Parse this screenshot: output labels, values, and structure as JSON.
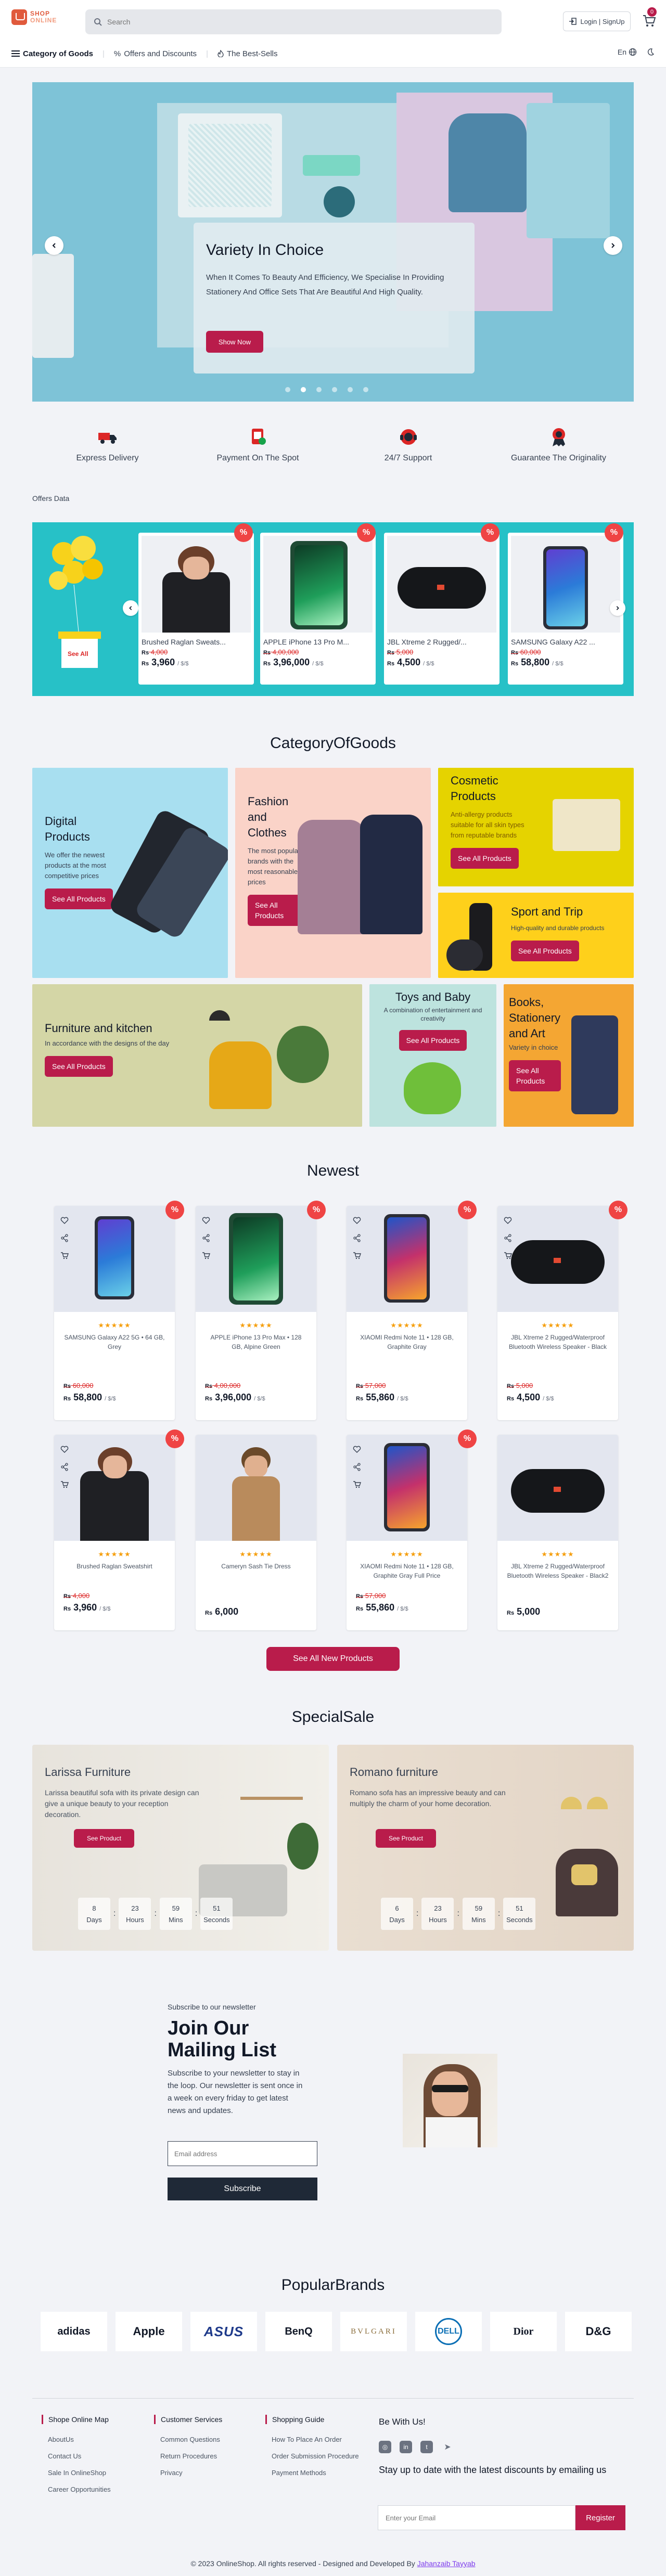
{
  "header": {
    "logo_line1": "SHOP",
    "logo_line2": "ONLINE",
    "search_placeholder": "Search",
    "login_label": "Login | SignUp",
    "cart_count": "0"
  },
  "nav": {
    "category": "Category of Goods",
    "offers": "Offers and Discounts",
    "best": "The Best-Sells",
    "lang": "En"
  },
  "hero": {
    "title": "Variety In Choice",
    "description": "When It Comes To Beauty And Efficiency, We Specialise In Providing Stationery And Office Sets That Are Beautiful And High Quality.",
    "button": "Show Now",
    "slide_count": 6,
    "active_slide": 2
  },
  "features": [
    {
      "label": "Express Delivery",
      "icon": "delivery-truck-icon"
    },
    {
      "label": "Payment On The Spot",
      "icon": "payment-icon"
    },
    {
      "label": "24/7 Support",
      "icon": "support-icon"
    },
    {
      "label": "Guarantee The Originality",
      "icon": "badge-icon"
    }
  ],
  "offers": {
    "section_label": "Offers Data",
    "gift_label": "See All",
    "items": [
      {
        "name": "Brushed Raglan Sweats...",
        "old": "4,000",
        "price": "3,960",
        "unit": "/ $/$",
        "discount": "%"
      },
      {
        "name": "APPLE iPhone 13 Pro M...",
        "old": "4,00,000",
        "price": "3,96,000",
        "unit": "/ $/$",
        "discount": "%"
      },
      {
        "name": "JBL Xtreme 2 Rugged/...",
        "old": "5,000",
        "price": "4,500",
        "unit": "/ $/$",
        "discount": "%"
      },
      {
        "name": "SAMSUNG Galaxy A22 ...",
        "old": "60,000",
        "price": "58,800",
        "unit": "/ $/$",
        "discount": "%"
      }
    ]
  },
  "categories": {
    "title": "CategoryOfGoods",
    "items": [
      {
        "title": "Digital Products",
        "desc": "We offer the newest products at the most competitive prices",
        "button": "See All Products"
      },
      {
        "title": "Fashion and Clothes",
        "desc": "The most popular brands with the most reasonable prices",
        "button": "See All Products"
      },
      {
        "title": "Cosmetic Products",
        "desc": "Anti-allergy products suitable for all skin types from reputable brands",
        "button": "See All Products"
      },
      {
        "title": "Sport and Trip",
        "desc": "High-quality and durable products",
        "button": "See All Products"
      },
      {
        "title": "Furniture and kitchen",
        "desc": "In accordance with the designs of the day",
        "button": "See All Products"
      },
      {
        "title": "Toys and Baby",
        "desc": "A combination of entertainment and creativity",
        "button": "See All Products"
      },
      {
        "title": "Books, Stationery and Art",
        "desc": "Variety in choice",
        "button": "See All Products"
      }
    ]
  },
  "newest": {
    "title": "Newest",
    "button": "See All New Products",
    "products": [
      {
        "name": "SAMSUNG Galaxy A22 5G • 64 GB, Grey",
        "old": "60,000",
        "price": "58,800",
        "unit": "/ $/$",
        "discount": "%",
        "stars": "★★★★★"
      },
      {
        "name": "APPLE iPhone 13 Pro Max • 128 GB, Alpine Green",
        "old": "4,00,000",
        "price": "3,96,000",
        "unit": "/ $/$",
        "discount": "%",
        "stars": "★★★★★"
      },
      {
        "name": "XIAOMI Redmi Note 11 • 128 GB, Graphite Gray",
        "old": "57,000",
        "price": "55,860",
        "unit": "/ $/$",
        "discount": "%",
        "stars": "★★★★★"
      },
      {
        "name": "JBL Xtreme 2 Rugged/Waterproof Bluetooth Wireless Speaker - Black",
        "old": "5,000",
        "price": "4,500",
        "unit": "/ $/$",
        "discount": "%",
        "stars": "★★★★★"
      },
      {
        "name": "Brushed Raglan Sweatshirt",
        "old": "4,000",
        "price": "3,960",
        "unit": "/ $/$",
        "discount": "%",
        "stars": "★★★★★"
      },
      {
        "name": "Cameryn Sash Tie Dress",
        "old": "",
        "price": "6,000",
        "unit": "",
        "discount": "",
        "stars": "★★★★★"
      },
      {
        "name": "XIAOMI Redmi Note 11 • 128 GB, Graphite Gray Full Price",
        "old": "57,000",
        "price": "55,860",
        "unit": "/ $/$",
        "discount": "%",
        "stars": "★★★★★"
      },
      {
        "name": "JBL Xtreme 2 Rugged/Waterproof Bluetooth Wireless Speaker - Black2",
        "old": "",
        "price": "5,000",
        "unit": "",
        "discount": "",
        "stars": "★★★★★"
      }
    ]
  },
  "special_sale": {
    "title": "SpecialSale",
    "items": [
      {
        "title": "Larissa Furniture",
        "desc": "Larissa beautiful sofa with its private design can give a unique beauty to your reception decoration.",
        "button": "See Product",
        "days": "8",
        "hours": "23",
        "mins": "59",
        "seconds": "51"
      },
      {
        "title": "Romano furniture",
        "desc": "Romano sofa has an impressive beauty and can multiply the charm of your home decoration.",
        "button": "See Product",
        "days": "6",
        "hours": "23",
        "mins": "59",
        "seconds": "51"
      }
    ],
    "labels": {
      "days": "Days",
      "hours": "Hours",
      "mins": "Mins",
      "seconds": "Seconds"
    }
  },
  "newsletter": {
    "small": "Subscribe to our newsletter",
    "title": "Join Our Mailing List",
    "desc": "Subscribe to your newsletter to stay in the loop. Our newsletter is sent once in a week on every friday to get latest news and updates.",
    "placeholder": "Email address",
    "button": "Subscribe"
  },
  "brands": {
    "title": "PopularBrands",
    "items": [
      "adidas",
      "Apple",
      "ASUS",
      "BenQ",
      "BVLGARI",
      "DELL",
      "Dior",
      "D&G"
    ]
  },
  "footer": {
    "col1": {
      "title": "Shope Online Map",
      "links": [
        "AboutUs",
        "Contact Us",
        "Sale In OnlineShop",
        "Career Opportunities"
      ]
    },
    "col2": {
      "title": "Customer Services",
      "links": [
        "Common Questions",
        "Return Procedures",
        "Privacy"
      ]
    },
    "col3": {
      "title": "Shopping Guide",
      "links": [
        "How To Place An Order",
        "Order Submission Procedure",
        "Payment Methods"
      ]
    },
    "social_title": "Be With Us!",
    "subscribe_text": "Stay up to date with the latest discounts by emailing us",
    "email_placeholder": "Enter your Email",
    "register": "Register",
    "copyright": "© 2023 OnlineShop. All rights reserved - Designed and Developed By",
    "author": "Jahanzaib Tayyab"
  }
}
